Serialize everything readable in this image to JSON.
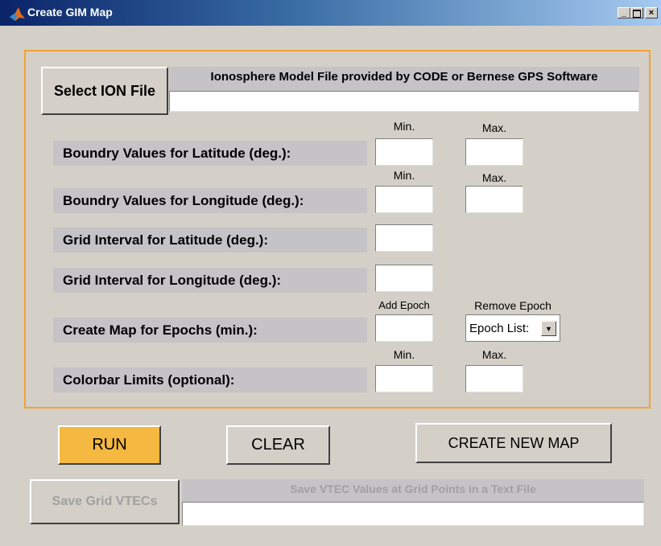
{
  "window": {
    "title": "Create GIM Map",
    "controls": [
      "minimize",
      "maximize",
      "close"
    ]
  },
  "ion": {
    "button_label": "Select ION File",
    "header_label": "Ionosphere Model File provided by CODE or Bernese GPS Software",
    "path_value": ""
  },
  "rows": {
    "lat_bounds_label": "Boundry Values for Latitude (deg.):",
    "lon_bounds_label": "Boundry Values for Longitude (deg.):",
    "lat_grid_label": "Grid Interval for Latitude (deg.):",
    "lon_grid_label": "Grid Interval for Longitude (deg.):",
    "epochs_label": "Create Map for Epochs (min.):",
    "colorbar_label": "Colorbar Limits (optional):"
  },
  "captions": {
    "min": "Min.",
    "max": "Max.",
    "add_epoch": "Add Epoch",
    "remove_epoch": "Remove Epoch"
  },
  "epoch_select": {
    "selected": "Epoch List:"
  },
  "actions": {
    "run_label": "RUN",
    "clear_label": "CLEAR",
    "create_new_label": "CREATE NEW MAP",
    "run_color": "#f5b942"
  },
  "save": {
    "button_label": "Save Grid VTECs",
    "header_label": "Save VTEC Values at Grid Points in a Text File",
    "path_value": ""
  }
}
